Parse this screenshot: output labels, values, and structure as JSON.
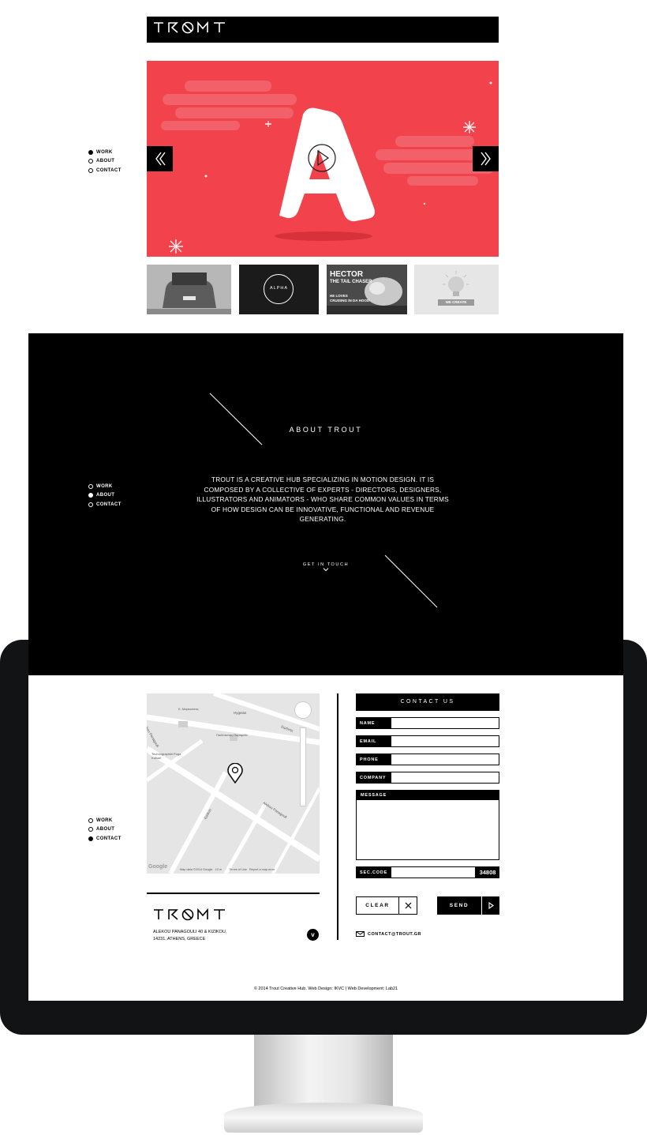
{
  "brand": {
    "logo_text": "TROUT"
  },
  "sidenav": {
    "items": [
      "WORK",
      "ABOUT",
      "CONTACT"
    ]
  },
  "work": {
    "hero_letter": "A",
    "thumbs": [
      {
        "label": ""
      },
      {
        "label": "ALPHA"
      },
      {
        "title": "HECTOR",
        "subtitle": "THE TAIL CHASER",
        "line1": "HE LOVES",
        "line2": "CRUISING IN DA HOOD"
      },
      {
        "label": "WE CREATE"
      }
    ]
  },
  "about": {
    "title": "ABOUT TROUT",
    "body": "TROUT IS A CREATIVE HUB SPECIALIZING IN MOTION DESIGN. IT IS COMPOSED BY A COLLECTIVE OF EXPERTS - DIRECTORS, DESIGNERS, ILLUSTRATORS AND ANIMATORS - WHO SHARE COMMON VALUES IN TERMS OF HOW DESIGN CAN BE INNOVATIVE, FUNCTIONAL AND REVENUE GENERATING.",
    "cta": "GET IN TOUCH"
  },
  "map": {
    "streets": [
      "Hygeias",
      "Alekou Panagouli",
      "Alekou Panagouli",
      "Kizikou",
      "Ειρήνης",
      "Κ. Μαρκούσας"
    ],
    "places": [
      "Technographiki Poga Kotsari",
      "Παιδότοπος Παραμύθι"
    ],
    "attribution": "Map data ©2014 Google",
    "scale": "10 m",
    "terms": "Terms of Use",
    "report": "Report a map error",
    "google": "Google"
  },
  "footer_info": {
    "address_line1": "ALEKOU PANAGOULI 40 & KIZIKOU,",
    "address_line2": "14231, ATHENS, GREECE",
    "email": "CONTACT@TROUT.GR",
    "copyright": "© 2014 Trout Creative Hub. Web Design: IKVC | Web Development: Lab21"
  },
  "contact": {
    "title": "CONTACT US",
    "fields": {
      "name": "NAME",
      "email": "EMAIL",
      "phone": "PHONE",
      "company": "COMPANY",
      "message": "MESSAGE",
      "sec_code": "SEC.CODE"
    },
    "sec_code_value": "34808",
    "clear_label": "CLEAR",
    "send_label": "SEND"
  },
  "colors": {
    "hero_red": "#f2434d",
    "black": "#000000",
    "bezel": "#121314"
  }
}
